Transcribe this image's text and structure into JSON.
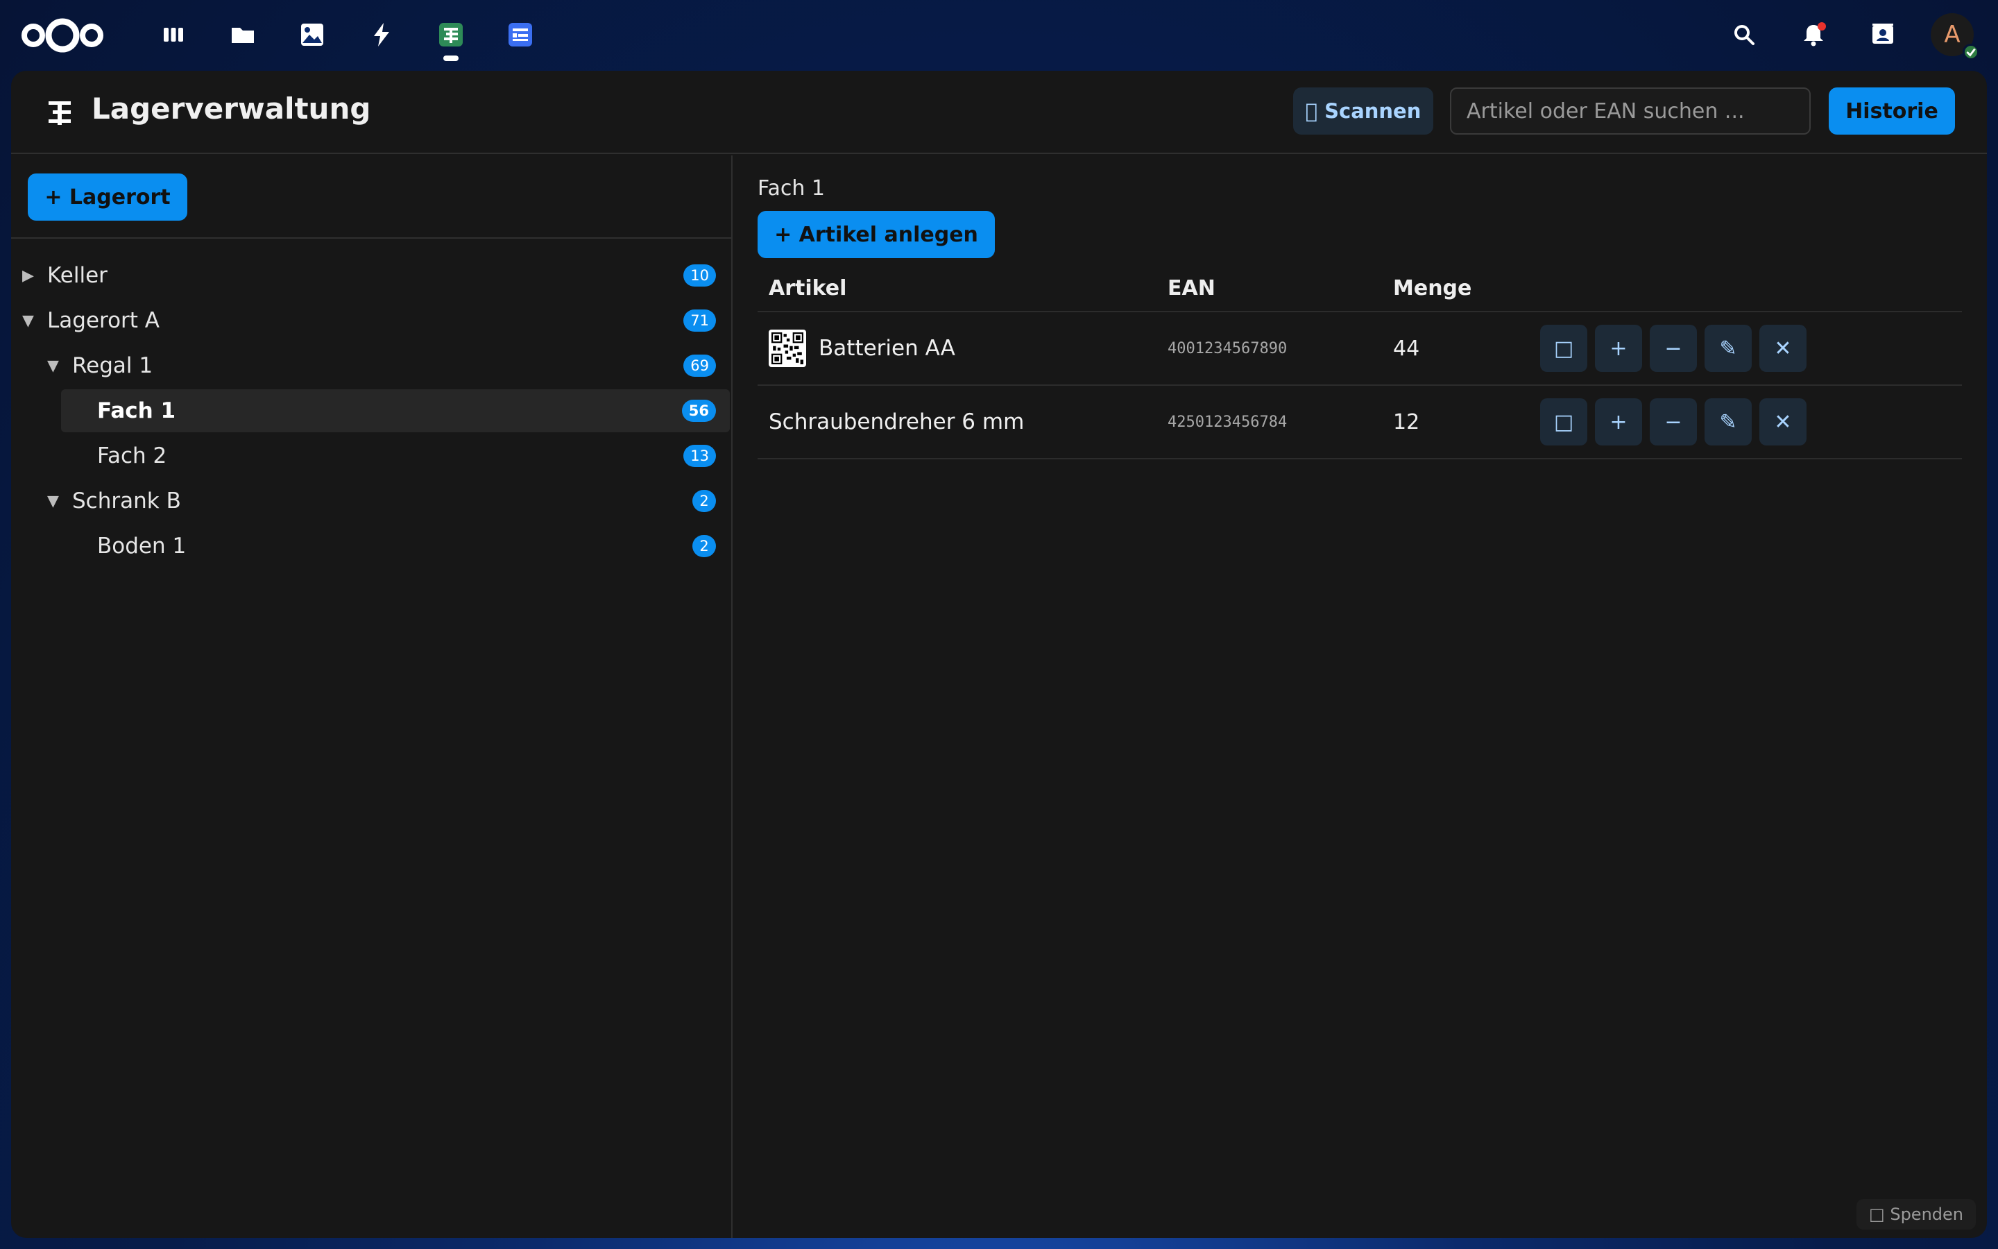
{
  "topbar": {
    "apps": [
      {
        "icon": "dashboard-icon"
      },
      {
        "icon": "files-icon"
      },
      {
        "icon": "photos-icon"
      },
      {
        "icon": "activity-icon"
      },
      {
        "icon": "inventory-app-icon",
        "active": true
      },
      {
        "icon": "forms-icon"
      }
    ],
    "avatar_letter": "A"
  },
  "header": {
    "title": "Lagerverwaltung",
    "scan_label": " Scannen",
    "search_placeholder": "Artikel oder EAN suchen ...",
    "history_label": "Historie"
  },
  "sidebar": {
    "add_location_label": "+ Lagerort",
    "tree": [
      {
        "label": "Keller",
        "count": "10",
        "level": 0,
        "expanded": false
      },
      {
        "label": "Lagerort A",
        "count": "71",
        "level": 0,
        "expanded": true
      },
      {
        "label": "Regal 1",
        "count": "69",
        "level": 1,
        "expanded": true
      },
      {
        "label": "Fach 1",
        "count": "56",
        "level": 2,
        "selected": true
      },
      {
        "label": "Fach 2",
        "count": "13",
        "level": 2
      },
      {
        "label": "Schrank B",
        "count": "2",
        "level": 1,
        "expanded": true
      },
      {
        "label": "Boden 1",
        "count": "2",
        "level": 2
      }
    ]
  },
  "main": {
    "breadcrumb": "Fach 1",
    "add_article_label": "+ Artikel anlegen",
    "columns": {
      "article": "Artikel",
      "ean": "EAN",
      "quantity": "Menge"
    },
    "rows": [
      {
        "name": "Batterien AA",
        "ean": "4001234567890",
        "quantity": "44",
        "has_qr": true
      },
      {
        "name": "Schraubendreher 6 mm",
        "ean": "4250123456784",
        "quantity": "12",
        "has_qr": false
      }
    ],
    "action_labels": {
      "qr": "□",
      "plus": "+",
      "minus": "−",
      "edit": "✎",
      "delete": "✕"
    }
  },
  "footer": {
    "donate_label": "□ Spenden"
  },
  "colors": {
    "accent": "#0a8ef0",
    "window_bg": "#171717",
    "secondary_btn": "#1d2a37"
  }
}
